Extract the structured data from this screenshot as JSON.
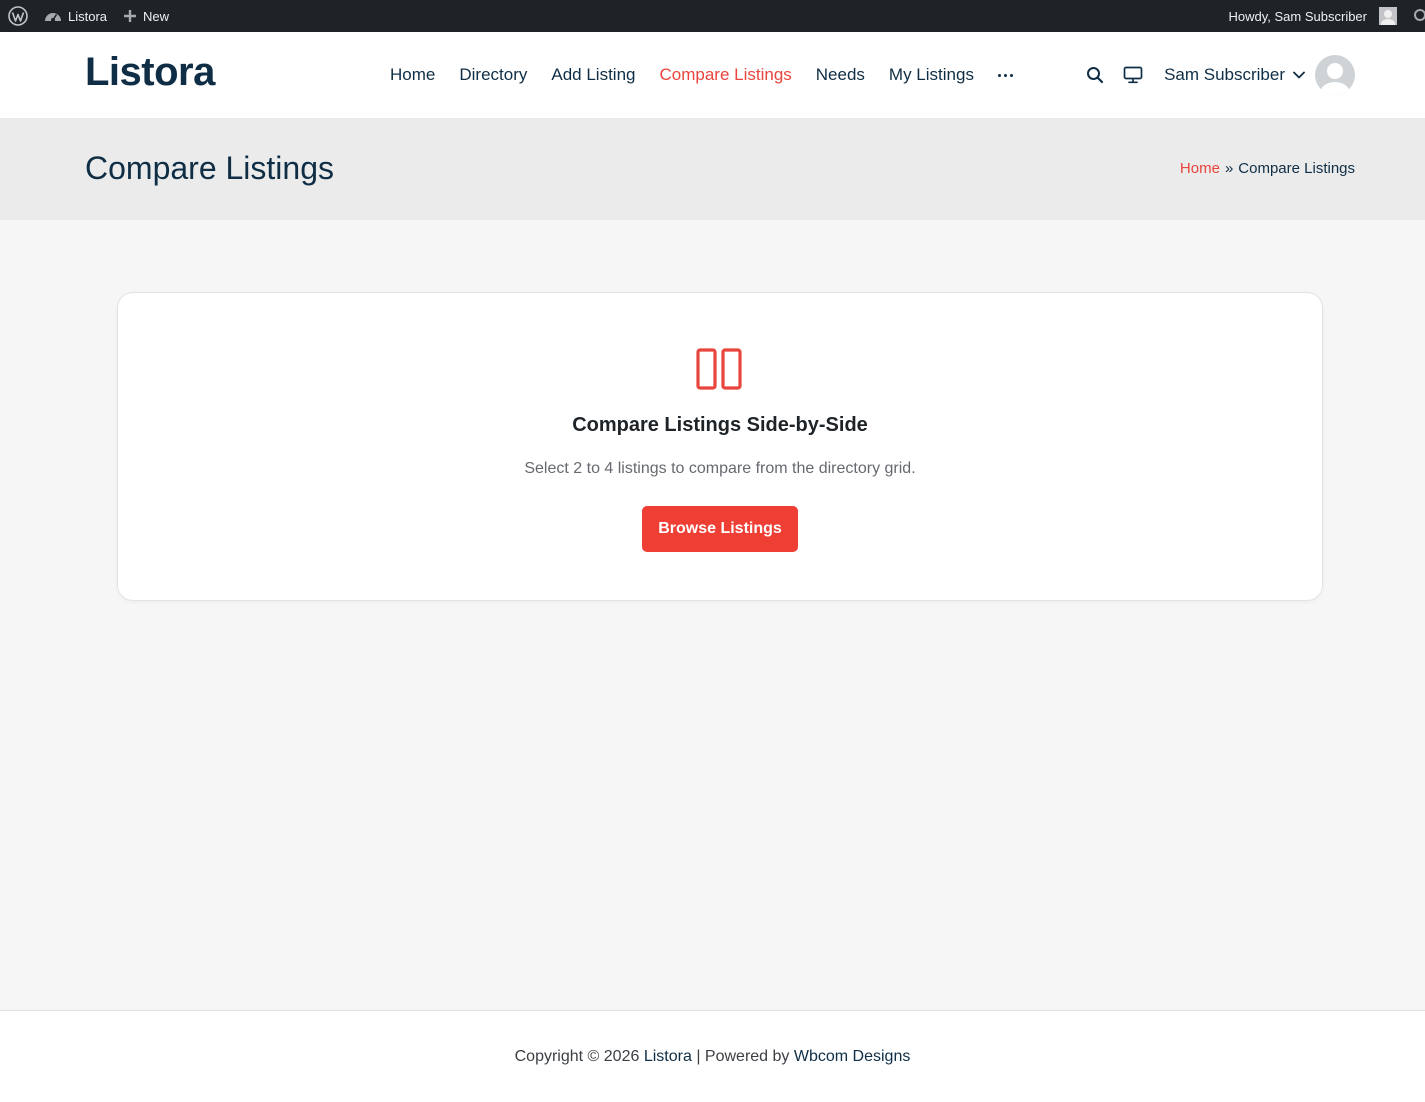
{
  "adminbar": {
    "site_name": "Listora",
    "new_label": "New",
    "greeting": "Howdy, Sam Subscriber"
  },
  "header": {
    "logo": "Listora",
    "nav": [
      {
        "label": "Home",
        "active": false
      },
      {
        "label": "Directory",
        "active": false
      },
      {
        "label": "Add Listing",
        "active": false
      },
      {
        "label": "Compare Listings",
        "active": true
      },
      {
        "label": "Needs",
        "active": false
      },
      {
        "label": "My Listings",
        "active": false
      }
    ],
    "user_name": "Sam Subscriber"
  },
  "titlebar": {
    "title": "Compare Listings",
    "breadcrumb_home": "Home",
    "breadcrumb_sep": "»",
    "breadcrumb_current": "Compare Listings"
  },
  "empty_state": {
    "icon": "compare-columns-icon",
    "title": "Compare Listings Side-by-Side",
    "description": "Select 2 to 4 listings to compare from the directory grid.",
    "button_label": "Browse Listings"
  },
  "footer": {
    "prefix": "Copyright © 2026",
    "site_link": "Listora",
    "separator": "|",
    "powered_by": "Powered by",
    "credit_link": "Wbcom Designs"
  },
  "colors": {
    "accent": "#ef3f35",
    "navy": "#0f2e45",
    "adminbar": "#1d2327"
  }
}
